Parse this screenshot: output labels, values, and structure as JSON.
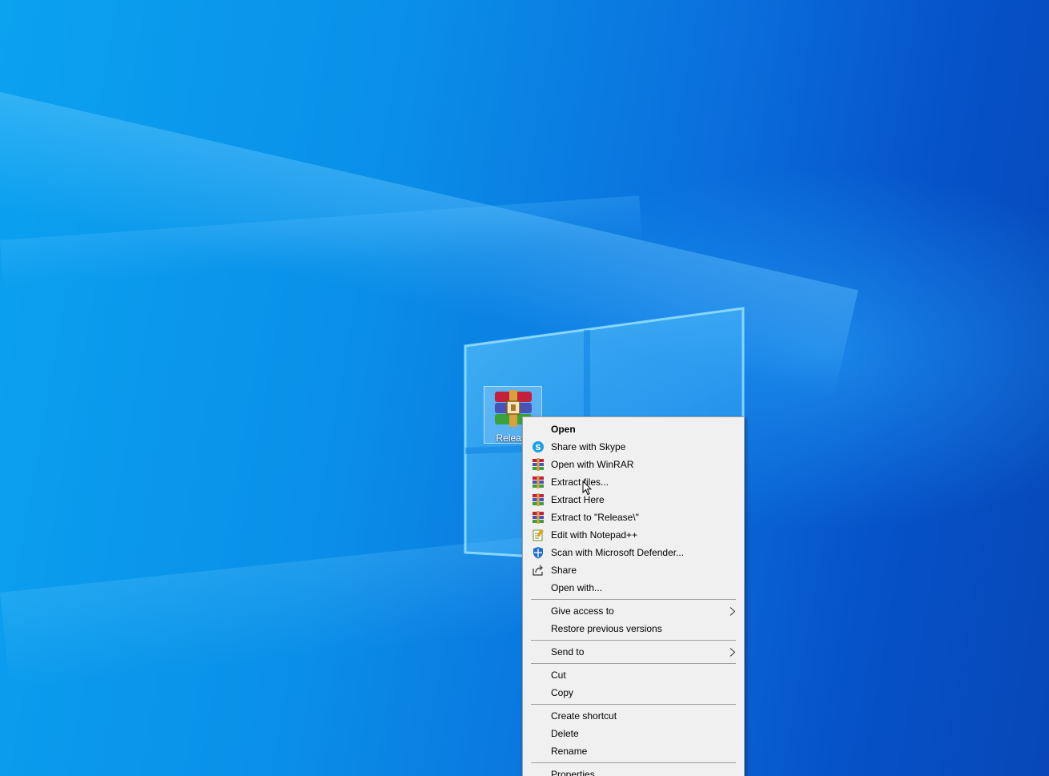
{
  "desktop": {
    "icon": {
      "label": "Release",
      "icon": "winrar-archive-icon"
    }
  },
  "context_menu": {
    "items": [
      {
        "label": "Open",
        "bold": true
      },
      {
        "label": "Share with Skype",
        "icon": "skype-icon"
      },
      {
        "label": "Open with WinRAR",
        "icon": "winrar-icon"
      },
      {
        "label": "Extract files...",
        "icon": "winrar-icon"
      },
      {
        "label": "Extract Here",
        "icon": "winrar-icon"
      },
      {
        "label": "Extract to \"Release\\\"",
        "icon": "winrar-icon"
      },
      {
        "label": "Edit with Notepad++",
        "icon": "notepad-plus-plus-icon"
      },
      {
        "label": "Scan with Microsoft Defender...",
        "icon": "defender-shield-icon"
      },
      {
        "label": "Share",
        "icon": "share-icon"
      },
      {
        "label": "Open with..."
      },
      {
        "label": "Give access to",
        "submenu": true
      },
      {
        "label": "Restore previous versions"
      },
      {
        "label": "Send to",
        "submenu": true
      },
      {
        "label": "Cut"
      },
      {
        "label": "Copy"
      },
      {
        "label": "Create shortcut"
      },
      {
        "label": "Delete"
      },
      {
        "label": "Rename"
      },
      {
        "label": "Properties"
      }
    ]
  },
  "colors": {
    "menu_background": "#f0f0f0",
    "menu_border": "#a0a0a0",
    "desktop_blue": "#0a6fdc"
  }
}
